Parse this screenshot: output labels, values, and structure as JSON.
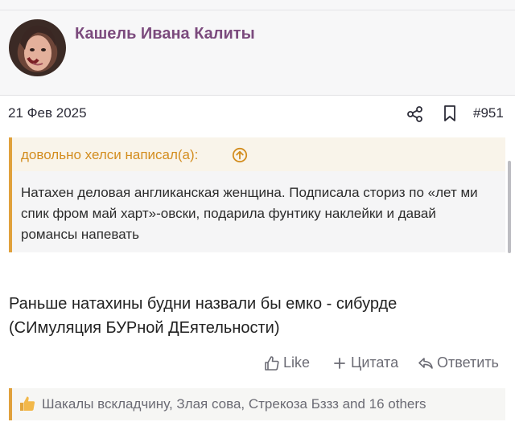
{
  "thread": {
    "author": "Кашель Ивана Калиты"
  },
  "post": {
    "date": "21 Фев 2025",
    "number": "#951",
    "quote": {
      "header": "довольно хелси написал(а):",
      "text": "Натахен деловая англиканская женщина. Подписала сториз по «лет ми спик фром май харт»-овски, подарила фунтику наклейки и давай романсы напевать"
    },
    "body_line1": "Раньше натахины будни назвали бы емко - сибурде",
    "body_line2": "(СИмуляция БУРной ДЕятельности)",
    "actions": {
      "like": "Like",
      "quote": "Цитата",
      "reply": "Ответить"
    },
    "likes_text": "Шакалы вскладчину, Злая сова, Стрекоза Бззз and 16 others"
  },
  "colors": {
    "author": "#7b4a7d",
    "quote_accent": "#e0a13c",
    "muted": "#6b6b74"
  },
  "icons": [
    "share-icon",
    "bookmark-icon",
    "arrow-up-circle-icon",
    "thumbs-up-icon",
    "plus-icon",
    "reply-icon"
  ]
}
